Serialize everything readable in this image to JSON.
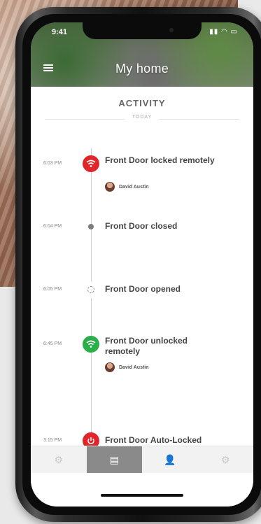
{
  "status_bar": {
    "time": "9:41",
    "icons": "▮▮ ◠ ▭"
  },
  "header": {
    "title": "My home",
    "menu_icon": "hamburger-menu-icon"
  },
  "activity": {
    "title": "ACTIVITY",
    "day_label": "TODAY",
    "events": [
      {
        "time": "6:03 PM",
        "text": "Front Door locked remotely",
        "user": "David Austin",
        "marker": "wifi-lock-red",
        "icon": "wifi-icon"
      },
      {
        "time": "6:04 PM",
        "text": "Front Door closed",
        "user": "",
        "marker": "dot-gray",
        "icon": ""
      },
      {
        "time": "6:05 PM",
        "text": "Front Door opened",
        "user": "",
        "marker": "dashed-ring",
        "icon": ""
      },
      {
        "time": "6:45 PM",
        "text": "Front Door unlocked remotely",
        "user": "David Austin",
        "marker": "wifi-unlock-green",
        "icon": "wifi-icon"
      },
      {
        "time": "3:15 PM",
        "text": "Front Door Auto-Locked",
        "user": "",
        "marker": "power-red",
        "icon": "power-icon"
      }
    ]
  },
  "tabbar": {
    "tabs": [
      {
        "name": "settings-tab",
        "icon": "⚙"
      },
      {
        "name": "activity-tab",
        "icon": "▤",
        "active": true
      },
      {
        "name": "users-tab",
        "icon": "👤"
      },
      {
        "name": "gear-tab",
        "icon": "⚙"
      }
    ]
  },
  "colors": {
    "red": "#e0262b",
    "green": "#2aae4a",
    "active_tab": "#8a8a8a"
  }
}
